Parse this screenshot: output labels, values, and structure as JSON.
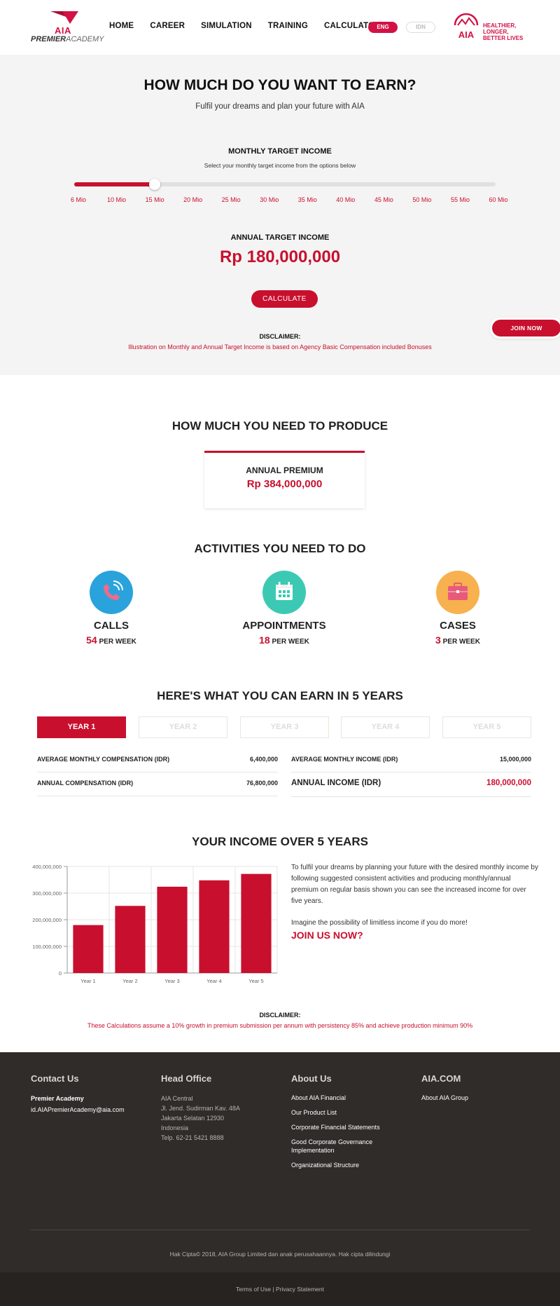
{
  "header": {
    "logo_text": "AIA",
    "logo_sub_bold": "PREMIER",
    "logo_sub": "ACADEMY",
    "nav": [
      "HOME",
      "CAREER",
      "SIMULATION",
      "TRAINING",
      "CALCULATOR"
    ],
    "lang_active": "ENG",
    "lang_inactive": "IDN",
    "tagline_1": "HEALTHIER, LONGER,",
    "tagline_2": "BETTER LIVES"
  },
  "hero": {
    "title": "HOW MUCH DO YOU WANT TO EARN?",
    "subtitle": "Fulfil your dreams and plan your future with AIA",
    "monthly_label": "MONTHLY TARGET INCOME",
    "monthly_hint": "Select your monthly target income from the options below",
    "slider_options": [
      "6 Mio",
      "10 Mio",
      "15 Mio",
      "20 Mio",
      "25 Mio",
      "30 Mio",
      "35 Mio",
      "40 Mio",
      "45 Mio",
      "50 Mio",
      "55 Mio",
      "60 Mio"
    ],
    "slider_selected_index": 2,
    "annual_label": "ANNUAL TARGET INCOME",
    "annual_value": "Rp 180,000,000",
    "calculate_label": "CALCULATE",
    "disclaimer_title": "DISCLAIMER:",
    "disclaimer_text": "Illustration on Monthly and Annual Target Income is based on Agency Basic Compensation included Bonuses",
    "join_now_label": "JOIN NOW"
  },
  "produce": {
    "title": "HOW MUCH YOU NEED TO PRODUCE",
    "premium_label": "ANNUAL PREMIUM",
    "premium_value": "Rp 384,000,000"
  },
  "activities": {
    "title": "ACTIVITIES YOU NEED TO DO",
    "items": [
      {
        "name": "CALLS",
        "count": "54",
        "unit": "PER WEEK",
        "icon": "phone-icon",
        "color": "#2aa3dc"
      },
      {
        "name": "APPOINTMENTS",
        "count": "18",
        "unit": "PER WEEK",
        "icon": "calendar-icon",
        "color": "#3cc9b4"
      },
      {
        "name": "CASES",
        "count": "3",
        "unit": "PER WEEK",
        "icon": "briefcase-icon",
        "color": "#f7b14f"
      }
    ]
  },
  "earn": {
    "title": "HERE'S WHAT YOU CAN EARN IN 5 YEARS",
    "tabs": [
      "YEAR 1",
      "YEAR 2",
      "YEAR 3",
      "YEAR 4",
      "YEAR 5"
    ],
    "active_tab": 0,
    "avg_monthly_comp_label": "AVERAGE MONTHLY COMPENSATION (IDR)",
    "avg_monthly_comp_value": "6,400,000",
    "annual_comp_label": "ANNUAL COMPENSATION (IDR)",
    "annual_comp_value": "76,800,000",
    "avg_monthly_income_label": "AVERAGE MONTHLY INCOME (IDR)",
    "avg_monthly_income_value": "15,000,000",
    "annual_income_label": "ANNUAL INCOME (IDR)",
    "annual_income_value": "180,000,000"
  },
  "income": {
    "title": "YOUR INCOME OVER 5 YEARS",
    "para1": "To fulfil your dreams by planning your future with the desired monthly income by following suggested consistent activities and producing monthly/annual premium on regular basis shown you can see the increased income for over five years.",
    "para2": "Imagine the possibility of limitless income if you do more!",
    "join_us": "JOIN US NOW?",
    "disclaimer_title": "DISCLAIMER:",
    "disclaimer_text": "These Calculations assume a 10% growth in premium submission per annum with persistency 85% and achieve production minimum 90%"
  },
  "chart_data": {
    "type": "bar",
    "categories": [
      "Year 1",
      "Year 2",
      "Year 3",
      "Year 4",
      "Year 5"
    ],
    "values": [
      180000000,
      252000000,
      324000000,
      348000000,
      372000000
    ],
    "ylim": [
      0,
      400000000
    ],
    "yticks": [
      0,
      100000000,
      200000000,
      300000000,
      400000000
    ],
    "ytick_labels": [
      "0",
      "100,000,000",
      "200,000,000",
      "300,000,000",
      "400,000,000"
    ],
    "grid": true,
    "color": "#c8102e"
  },
  "footer": {
    "contact_title": "Contact Us",
    "contact_name": "Premier Academy",
    "contact_email": "id.AIAPremierAcademy@aia.com",
    "office_title": "Head Office",
    "office_lines": [
      "AIA Central",
      "Jl. Jend. Sudirman Kav. 48A",
      "Jakarta Selatan 12930",
      "Indonesia",
      "Telp. 62-21 5421 8888"
    ],
    "about_title": "About Us",
    "about_links": [
      "About AIA Financial",
      "Our Product List",
      "Corporate Financial Statements",
      "Good Corporate Governance Implementation",
      "Organizational Structure"
    ],
    "aiacom_title": "AIA.COM",
    "aiacom_links": [
      "About AIA Group"
    ],
    "copyright": "Hak Cipta© 2018, AIA Group Limited dan anak perusahaannya. Hak cipta dilindungi",
    "terms": "Terms of Use",
    "separator": "|",
    "privacy": "Privacy Statement"
  }
}
